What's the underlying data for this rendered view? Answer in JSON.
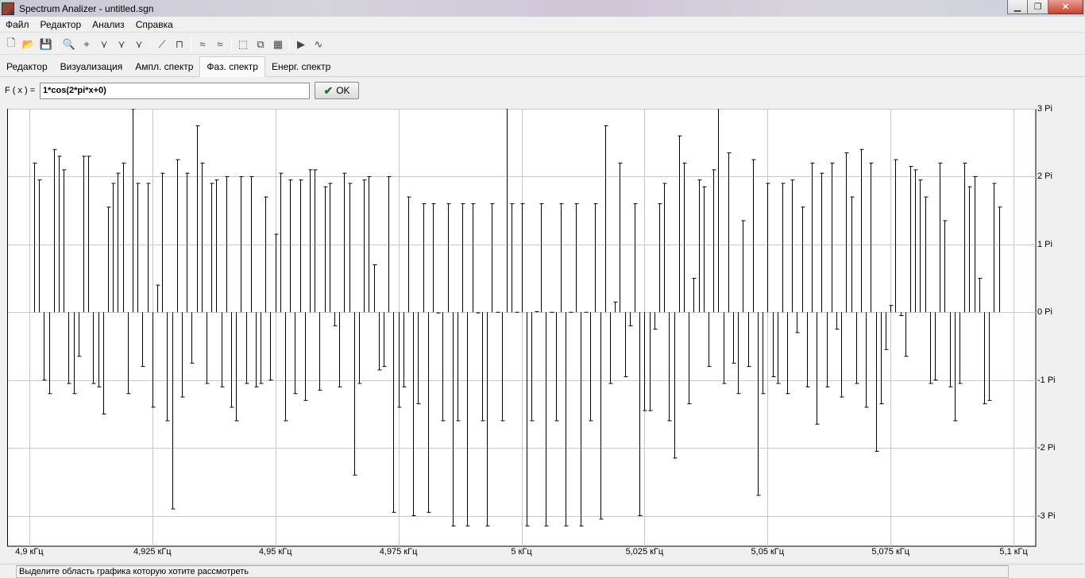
{
  "window": {
    "title": "Spectrum Analizer - untitled.sgn",
    "minimize": "▁",
    "maximize": "❐",
    "close": "✕"
  },
  "menu": [
    "Файл",
    "Редактор",
    "Анализ",
    "Справка"
  ],
  "toolbar": [
    {
      "name": "new-icon",
      "glyph": "🗋"
    },
    {
      "name": "open-icon",
      "glyph": "📂"
    },
    {
      "name": "save-icon",
      "glyph": "💾"
    },
    {
      "sep": true
    },
    {
      "name": "zoom-icon",
      "glyph": "🔍"
    },
    {
      "name": "crosshair-icon",
      "glyph": "⌖"
    },
    {
      "name": "tool-a-icon",
      "glyph": "⋎"
    },
    {
      "name": "tool-b-icon",
      "glyph": "⋎"
    },
    {
      "name": "tool-c-icon",
      "glyph": "⋎"
    },
    {
      "sep": true
    },
    {
      "name": "line-icon",
      "glyph": "⟋"
    },
    {
      "name": "hand-icon",
      "glyph": "⊓"
    },
    {
      "sep": true
    },
    {
      "name": "wave-a-icon",
      "glyph": "≈"
    },
    {
      "name": "wave-b-icon",
      "glyph": "≈"
    },
    {
      "sep": true
    },
    {
      "name": "zoom-region-icon",
      "glyph": "⬚"
    },
    {
      "name": "zoom-fit-icon",
      "glyph": "⧉"
    },
    {
      "name": "export-icon",
      "glyph": "▦"
    },
    {
      "sep": true
    },
    {
      "name": "play-icon",
      "glyph": "▶"
    },
    {
      "name": "signal-icon",
      "glyph": "∿"
    }
  ],
  "tabs": [
    "Редактор",
    "Визуализация",
    "Ампл. спектр",
    "Фаз. спектр",
    "Енерг. спектр"
  ],
  "active_tab": 3,
  "formula": {
    "label": "F ( x ) =",
    "value": "1*cos(2*pi*x+0)",
    "ok_label": "OK"
  },
  "status": "Выделите область графика которую хотите рассмотреть",
  "chart_data": {
    "type": "bar",
    "xlabel": "",
    "ylabel": "",
    "x_ticks": [
      4.9,
      4.925,
      4.95,
      4.975,
      5.0,
      5.025,
      5.05,
      5.075,
      5.1
    ],
    "x_tick_labels": [
      "4,9 кГц",
      "4,925 кГц",
      "4,95 кГц",
      "4,975 кГц",
      "5 кГц",
      "5,025 кГц",
      "5,05 кГц",
      "5,075 кГц",
      "5,1 кГц"
    ],
    "y_ticks": [
      3,
      2,
      1,
      0,
      -1,
      -2,
      -3
    ],
    "y_tick_labels": [
      "3 Pi",
      "2 Pi",
      "1 Pi",
      "0 Pi",
      "-1 Pi",
      "-2 Pi",
      "-3 Pi"
    ],
    "xlim": [
      4.8955,
      5.1045
    ],
    "ylim": [
      -3.45,
      3.0
    ],
    "grid": true,
    "x_start": 4.901,
    "x_step": 0.001,
    "values": [
      2.2,
      1.95,
      -1.0,
      -1.2,
      2.4,
      2.3,
      2.1,
      -1.05,
      -1.2,
      -0.65,
      2.3,
      2.3,
      -1.05,
      -1.1,
      -1.5,
      1.55,
      1.9,
      2.05,
      2.2,
      -1.2,
      3.0,
      1.9,
      -0.8,
      1.9,
      -1.4,
      0.4,
      2.05,
      -1.6,
      -2.9,
      2.25,
      -1.25,
      2.05,
      -0.75,
      2.75,
      2.2,
      -1.05,
      1.9,
      1.95,
      -1.1,
      2.0,
      -1.4,
      -1.6,
      2.0,
      -1.05,
      2.0,
      -1.1,
      -1.05,
      1.7,
      -1.0,
      1.15,
      2.05,
      -1.6,
      1.95,
      -1.2,
      1.95,
      -1.3,
      2.1,
      2.1,
      -1.15,
      1.85,
      1.9,
      -0.2,
      -1.1,
      2.05,
      1.9,
      -2.4,
      -1.05,
      1.95,
      2.0,
      0.7,
      -0.85,
      -0.8,
      2.0,
      -2.95,
      -1.4,
      -1.1,
      1.7,
      -3.0,
      -1.35,
      1.6,
      -2.95,
      1.6,
      -0.01,
      -1.6,
      1.6,
      -3.15,
      -1.6,
      1.6,
      -3.15,
      1.6,
      -0.01,
      -1.6,
      -3.15,
      1.6,
      0.0,
      -1.6,
      3.1,
      1.6,
      0.0,
      1.6,
      -3.15,
      -1.6,
      0.01,
      1.6,
      -3.15,
      0.0,
      -1.6,
      1.6,
      -3.15,
      0.0,
      1.6,
      -3.15,
      0.0,
      -1.6,
      1.6,
      -3.05,
      2.75,
      -1.05,
      0.15,
      2.2,
      -0.95,
      -0.2,
      1.6,
      -3.0,
      -1.45,
      -1.45,
      -0.25,
      1.6,
      1.9,
      -1.6,
      -2.15,
      2.6,
      2.2,
      -1.35,
      0.5,
      1.95,
      1.85,
      -0.8,
      2.1,
      3.1,
      -1.05,
      2.35,
      -0.75,
      -1.2,
      1.35,
      -0.8,
      2.25,
      -2.7,
      -1.2,
      1.9,
      -0.95,
      -1.05,
      1.9,
      -1.2,
      1.95,
      -0.3,
      1.55,
      -1.1,
      2.2,
      -1.65,
      2.05,
      -1.1,
      2.2,
      -0.25,
      -1.25,
      2.35,
      1.7,
      -1.05,
      2.4,
      -1.4,
      2.2,
      -2.05,
      -1.35,
      -0.55,
      0.1,
      2.25,
      -0.05,
      -0.65,
      2.15,
      2.1,
      1.95,
      1.7,
      -1.05,
      -1.0,
      2.2,
      1.35,
      -1.1,
      -1.6,
      -1.05,
      2.2,
      1.85,
      2.0,
      0.5,
      -1.35,
      -1.3,
      1.9,
      1.55
    ]
  }
}
